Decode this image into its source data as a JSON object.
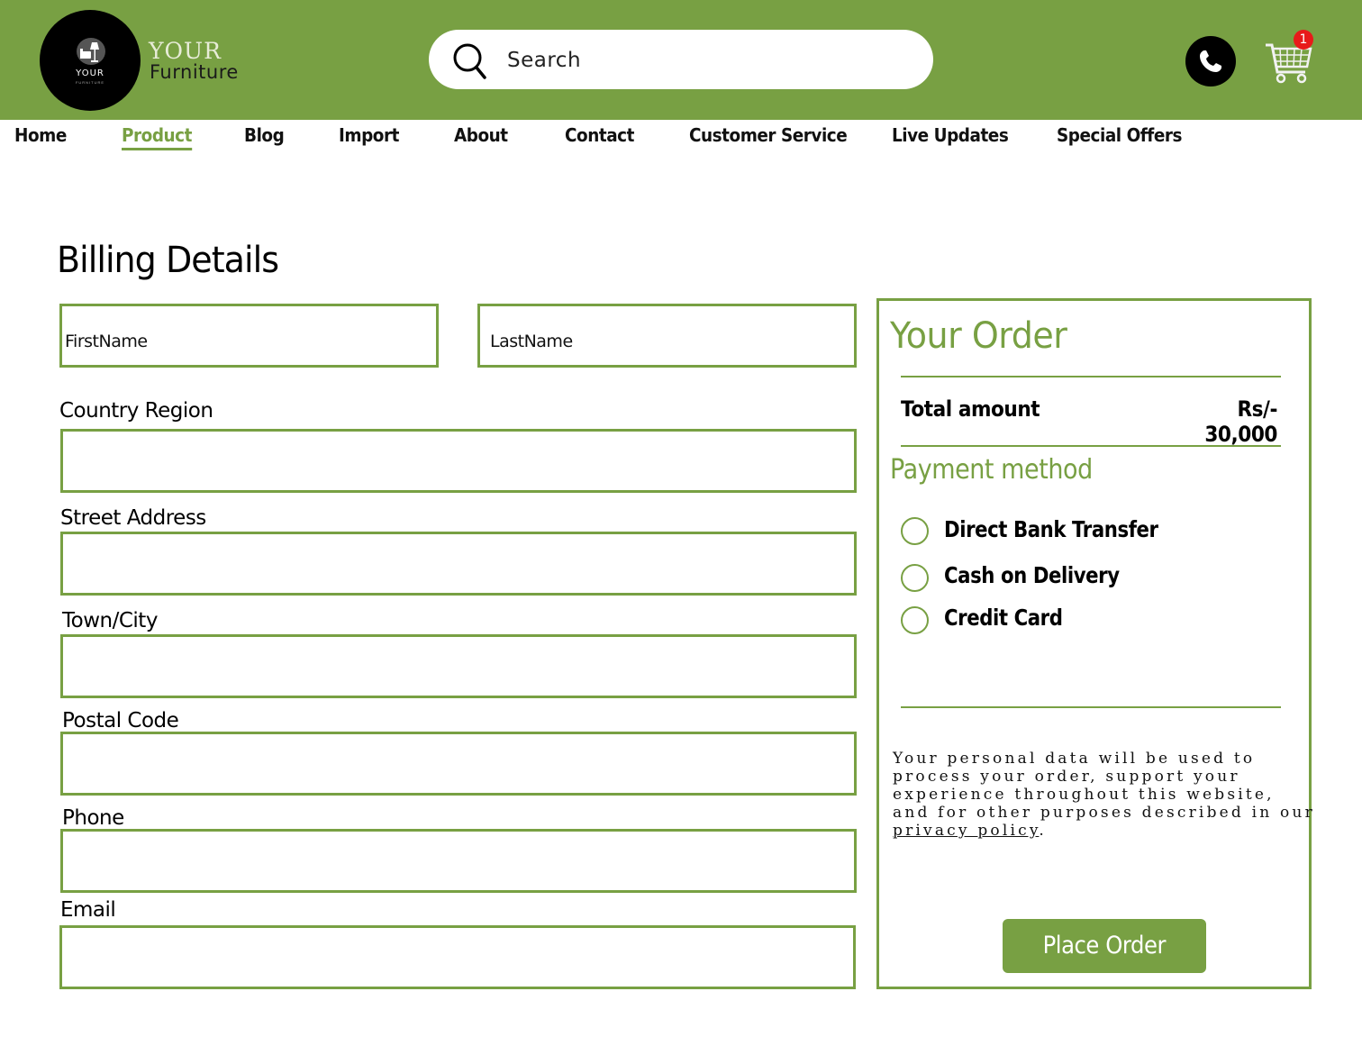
{
  "header": {
    "logo_small_text": "YOUR",
    "logo_tiny_text": "FURNITURE",
    "brand_top": "YOUR",
    "brand_bottom": "Furniture",
    "search_placeholder": "Search",
    "cart_count": "1",
    "accent_color": "#78a043"
  },
  "nav": {
    "items": [
      {
        "label": "Home",
        "active": false
      },
      {
        "label": "Product",
        "active": true
      },
      {
        "label": "Blog",
        "active": false
      },
      {
        "label": "Import",
        "active": false
      },
      {
        "label": "About",
        "active": false
      },
      {
        "label": "Contact",
        "active": false
      },
      {
        "label": "Customer Service",
        "active": false
      },
      {
        "label": "Live Updates",
        "active": false
      },
      {
        "label": "Special Offers",
        "active": false
      }
    ]
  },
  "billing": {
    "title": "Billing Details",
    "first_name_placeholder": "FirstName",
    "last_name_placeholder": "LastName",
    "country_label": "Country Region",
    "street_label": "Street Address",
    "town_label": "Town/City",
    "postal_label": "Postal Code",
    "phone_label": "Phone",
    "email_label": "Email"
  },
  "order": {
    "title": "Your Order",
    "total_label": "Total amount",
    "total_value": "Rs/- 30,000",
    "payment_title": "Payment method",
    "methods": [
      "Direct Bank Transfer",
      "Cash on Delivery",
      "Credit Card"
    ],
    "privacy_text": "Your personal data will be used to process your order,  support your experience throughout this website, and for other purposes described in our ",
    "privacy_link": "privacy policy",
    "privacy_end": ".",
    "place_order_label": "Place Order"
  },
  "icons": {
    "search": "search-icon",
    "phone": "phone-icon",
    "cart": "cart-icon",
    "logo": "lamp-icon"
  }
}
